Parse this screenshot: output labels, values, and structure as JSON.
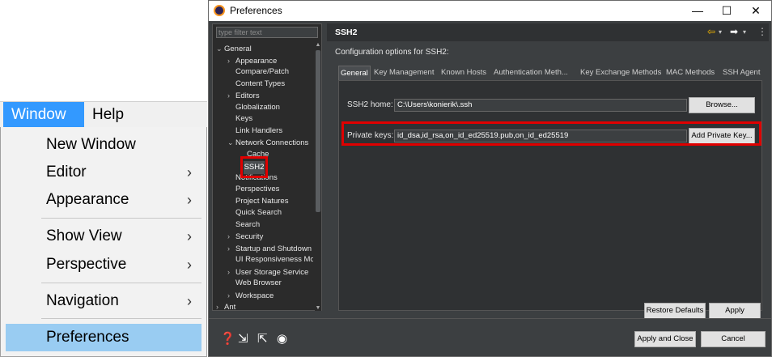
{
  "menubar": {
    "window": "Window",
    "help": "Help"
  },
  "window_menu": {
    "items": [
      {
        "label": "New Window",
        "arrow": ""
      },
      {
        "label": "Editor",
        "arrow": "›"
      },
      {
        "label": "Appearance",
        "arrow": "›"
      },
      {
        "label": "Show View",
        "arrow": "›"
      },
      {
        "label": "Perspective",
        "arrow": "›"
      },
      {
        "label": "Navigation",
        "arrow": "›"
      },
      {
        "label": "Preferences",
        "arrow": ""
      }
    ]
  },
  "dialog": {
    "title": "Preferences",
    "window_controls": {
      "minimize": "—",
      "maximize": "☐",
      "close": "✕"
    },
    "filter_placeholder": "type filter text",
    "tree": [
      {
        "label": "General",
        "twisty": "⌄"
      },
      {
        "label": "Appearance",
        "twisty": "›"
      },
      {
        "label": "Compare/Patch",
        "twisty": ""
      },
      {
        "label": "Content Types",
        "twisty": ""
      },
      {
        "label": "Editors",
        "twisty": "›"
      },
      {
        "label": "Globalization",
        "twisty": ""
      },
      {
        "label": "Keys",
        "twisty": ""
      },
      {
        "label": "Link Handlers",
        "twisty": ""
      },
      {
        "label": "Network Connections",
        "twisty": "⌄"
      },
      {
        "label": "Cache",
        "twisty": ""
      },
      {
        "label": "SSH2",
        "twisty": ""
      },
      {
        "label": "Notifications",
        "twisty": ""
      },
      {
        "label": "Perspectives",
        "twisty": ""
      },
      {
        "label": "Project Natures",
        "twisty": ""
      },
      {
        "label": "Quick Search",
        "twisty": ""
      },
      {
        "label": "Search",
        "twisty": ""
      },
      {
        "label": "Security",
        "twisty": "›"
      },
      {
        "label": "Startup and Shutdown",
        "twisty": "›"
      },
      {
        "label": "UI Responsiveness Monitoring",
        "twisty": ""
      },
      {
        "label": "User Storage Service",
        "twisty": "›"
      },
      {
        "label": "Web Browser",
        "twisty": ""
      },
      {
        "label": "Workspace",
        "twisty": "›"
      },
      {
        "label": "Ant",
        "twisty": "›"
      }
    ],
    "page_title": "SSH2",
    "description": "Configuration options for SSH2:",
    "tabs": [
      "General",
      "Key Management",
      "Known Hosts",
      "Authentication Meth...",
      "Key Exchange Methods",
      "MAC Methods",
      "SSH Agent"
    ],
    "ssh2_home_label": "SSH2 home:",
    "ssh2_home_value": "C:\\Users\\konierik\\.ssh",
    "browse_button": "Browse...",
    "private_keys_label": "Private keys:",
    "private_keys_value": "id_dsa,id_rsa,on_id_ed25519.pub,on_id_ed25519",
    "add_private_key_button": "Add Private Key...",
    "restore_defaults_button": "Restore Defaults",
    "apply_button": "Apply",
    "apply_close_button": "Apply and Close",
    "cancel_button": "Cancel"
  },
  "colors": {
    "dialog_bg": "#3c3f41",
    "highlight_red": "#e00000",
    "menu_selected": "#99ccf2",
    "menubar_active": "#3399ff"
  }
}
